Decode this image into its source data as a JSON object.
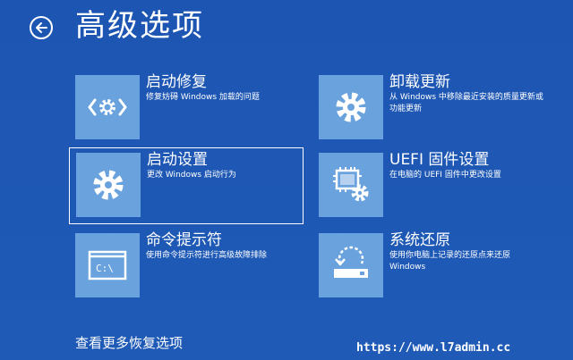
{
  "header": {
    "title": "高级选项",
    "back_icon": "back-arrow-circle-icon"
  },
  "tiles": [
    {
      "title": "启动修复",
      "description": "修复妨碍 Windows 加载的问题",
      "icon": "code-gear-icon"
    },
    {
      "title": "卸载更新",
      "description": "从 Windows 中移除最近安装的质量更新或功能更新",
      "icon": "gear-icon"
    },
    {
      "title": "启动设置",
      "description": "更改 Windows 启动行为",
      "icon": "gear-icon",
      "selected": true
    },
    {
      "title": "UEFI 固件设置",
      "description": "在电脑的 UEFI 固件中更改设置",
      "icon": "chip-gear-icon"
    },
    {
      "title": "命令提示符",
      "description": "使用命令提示符进行高级故障排除",
      "icon": "command-prompt-icon"
    },
    {
      "title": "系统还原",
      "description": "使用你电脑上记录的还原点来还原 Windows",
      "icon": "restore-icon"
    }
  ],
  "footer": {
    "more_options": "查看更多恢复选项",
    "watermark": "https://www.l7admin.cc"
  },
  "colors": {
    "background": "#1e58b4",
    "tile_icon_bg": "#6aa2de",
    "text": "#ffffff"
  }
}
